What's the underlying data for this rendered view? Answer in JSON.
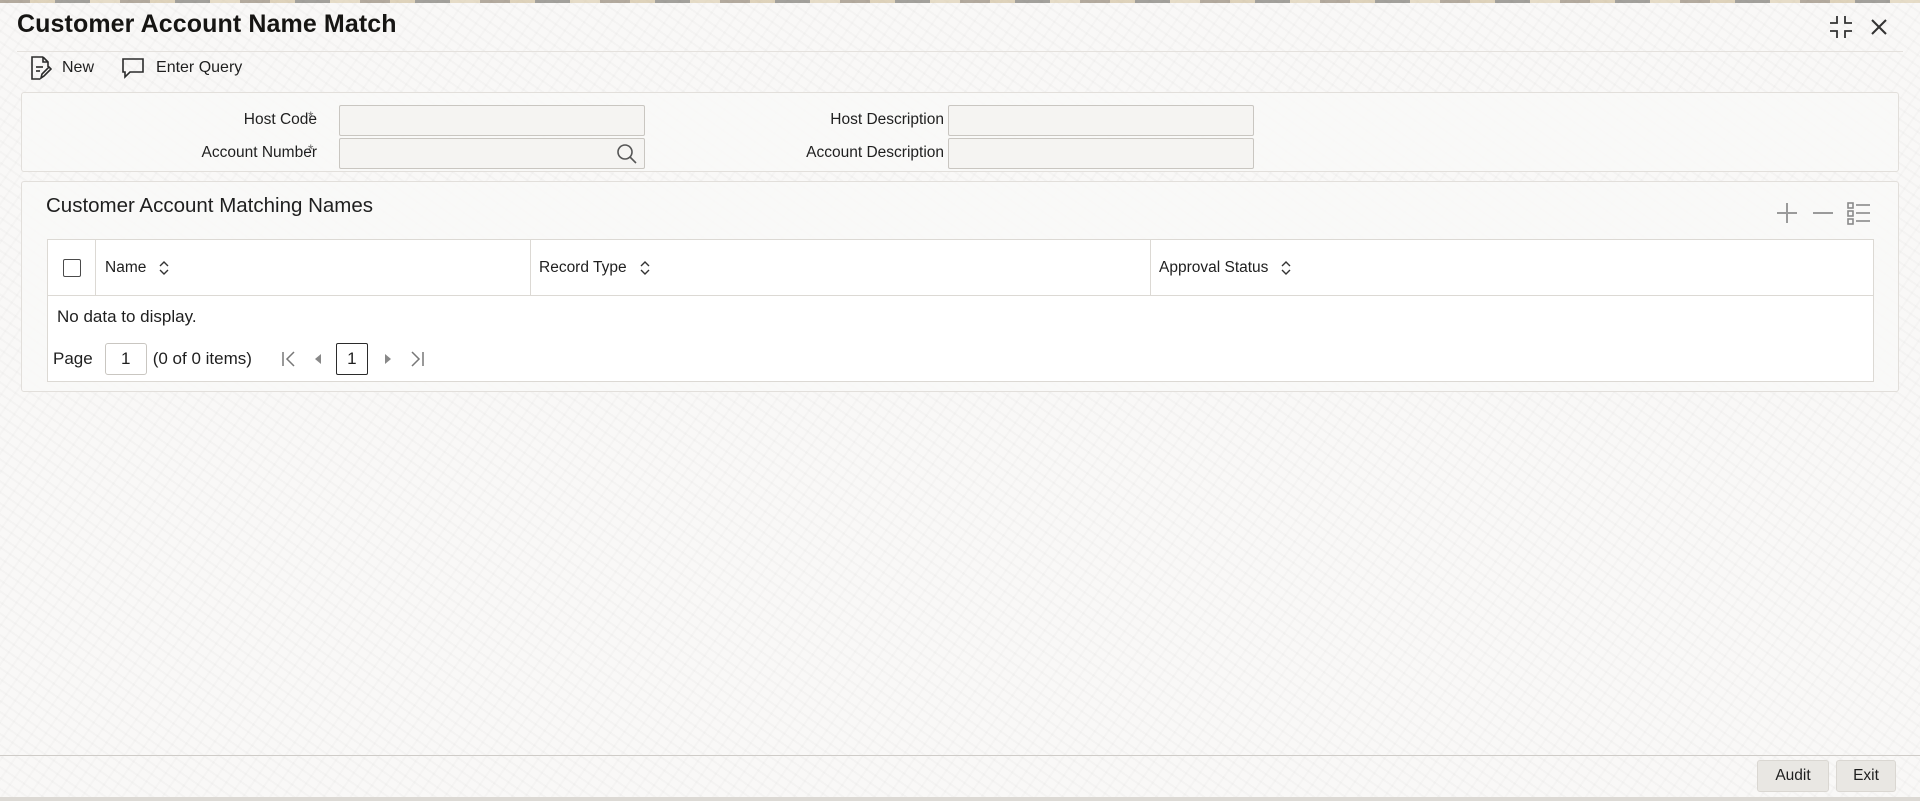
{
  "window": {
    "title": "Customer Account Name Match",
    "controls": [
      "collapse-icon",
      "close-icon"
    ]
  },
  "toolbar": {
    "new_label": "New",
    "new_icon": "new-document-icon",
    "enter_query_label": "Enter Query",
    "enter_query_icon": "query-icon"
  },
  "form": {
    "host_code": {
      "label": "Host Code",
      "required": "*",
      "value": ""
    },
    "account_number": {
      "label": "Account Number",
      "required": "*",
      "value": "",
      "lookup_icon": "search-icon"
    },
    "host_description": {
      "label": "Host Description",
      "value": ""
    },
    "account_description": {
      "label": "Account Description",
      "value": ""
    }
  },
  "grid": {
    "title": "Customer Account Matching Names",
    "actions": [
      "add-icon",
      "remove-icon",
      "list-icon"
    ],
    "columns": [
      "Name",
      "Record Type",
      "Approval Status"
    ],
    "rows": [],
    "empty_message": "No data to display.",
    "pagination": {
      "page_label": "Page",
      "page_value": "1",
      "items_text": "(0 of 0 items)",
      "current_page": "1"
    }
  },
  "footer": {
    "audit_label": "Audit",
    "exit_label": "Exit"
  },
  "colors": {
    "background": "#f9f8f7",
    "border": "#dcd9d4",
    "text": "#1f1f1f",
    "button_bg": "#e9e7e3"
  }
}
